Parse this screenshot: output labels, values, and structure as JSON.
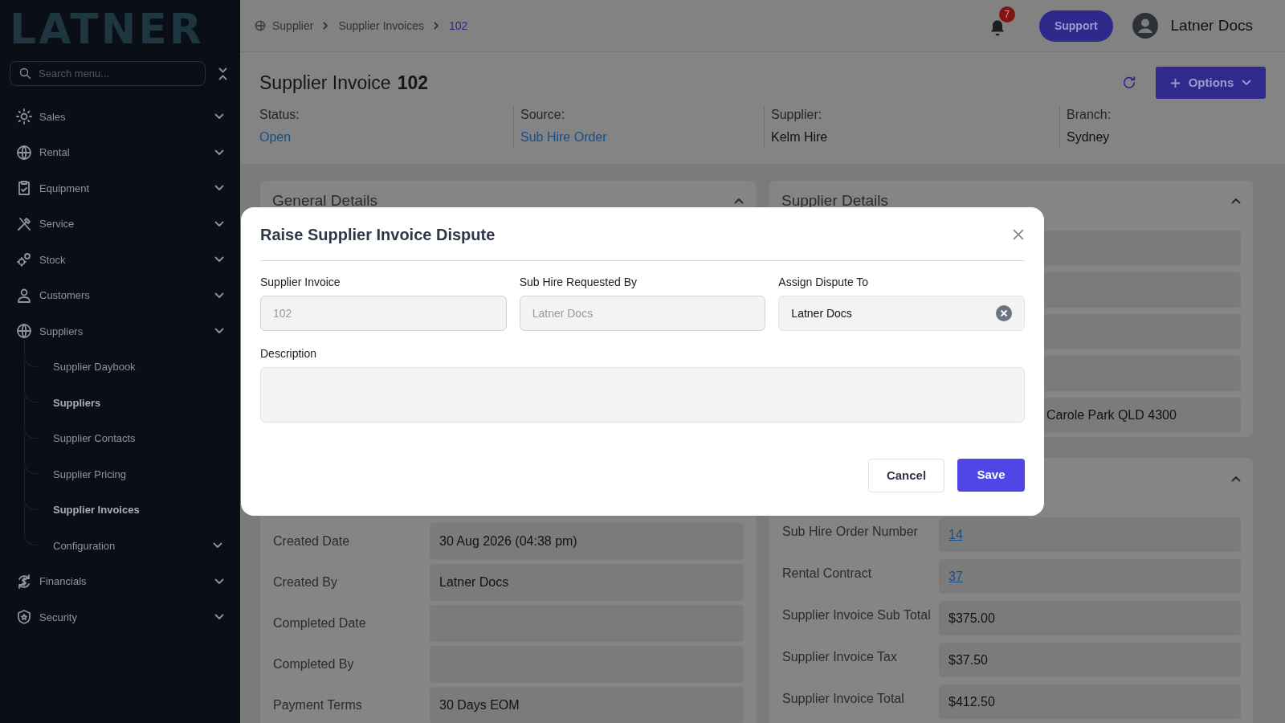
{
  "sidebar": {
    "logo": "LATNER",
    "search": {
      "placeholder": "Search menu..."
    },
    "items": [
      {
        "label": "Sales"
      },
      {
        "label": "Rental"
      },
      {
        "label": "Equipment"
      },
      {
        "label": "Service"
      },
      {
        "label": "Stock"
      },
      {
        "label": "Customers"
      },
      {
        "label": "Suppliers",
        "children": [
          {
            "label": "Supplier Daybook",
            "selected": false,
            "submenu": false
          },
          {
            "label": "Suppliers",
            "selected": true,
            "submenu": false
          },
          {
            "label": "Supplier Contacts",
            "selected": false,
            "submenu": false
          },
          {
            "label": "Supplier Pricing",
            "selected": false,
            "submenu": false
          },
          {
            "label": "Supplier Invoices",
            "selected": true,
            "submenu": false
          },
          {
            "label": "Configuration",
            "selected": false,
            "submenu": true
          }
        ]
      },
      {
        "label": "Financials"
      },
      {
        "label": "Security"
      }
    ]
  },
  "breadcrumb": [
    {
      "label": "Supplier",
      "current": false
    },
    {
      "label": "Supplier Invoices",
      "current": false
    },
    {
      "label": "102",
      "current": true
    }
  ],
  "topbar": {
    "notification_count": "7",
    "support_button": "Support",
    "user_name": "Latner Docs"
  },
  "page": {
    "title": "Supplier Invoice",
    "number": "102",
    "options_button": "Options",
    "summary": [
      {
        "label": "Status:",
        "value": "Open",
        "link": true
      },
      {
        "label": "Source:",
        "value": "Sub Hire Order",
        "link": true
      },
      {
        "label": "Supplier:",
        "value": "Kelm Hire",
        "link": false
      },
      {
        "label": "Branch:",
        "value": "Sydney",
        "link": false
      }
    ]
  },
  "general_details": {
    "title": "General Details",
    "expanded": true,
    "rows": [
      {
        "label": "Created Date",
        "value": "30 Aug 2026 (04:38 pm)"
      },
      {
        "label": "Created By",
        "value": "Latner Docs"
      },
      {
        "label": "Completed Date"
      },
      {
        "label": "Completed By"
      },
      {
        "label": "Payment Terms",
        "value": "30 Days EOM"
      }
    ]
  },
  "supplier_details": {
    "title": "Supplier Details",
    "expanded": true,
    "address_tail": "Carole Park QLD 4300"
  },
  "sub_hire_card": {
    "expanded": true,
    "rows": [
      {
        "label": "Sub Hire Order Number",
        "value": "14",
        "link": true
      },
      {
        "label": "Rental Contract",
        "value": "37",
        "link": true
      },
      {
        "label": "Supplier Invoice Sub Total",
        "value": "$375.00",
        "link": false
      },
      {
        "label": "Supplier Invoice Tax",
        "value": "$37.50",
        "link": false
      },
      {
        "label": "Supplier Invoice Total",
        "value": "$412.50",
        "link": false
      }
    ]
  },
  "modal": {
    "title": "Raise Supplier Invoice Dispute",
    "fields": [
      {
        "label": "Supplier Invoice",
        "value": "102",
        "disabled": true,
        "clearable": false
      },
      {
        "label": "Sub Hire Requested By",
        "value": "Latner Docs",
        "disabled": true,
        "clearable": false
      },
      {
        "label": "Assign Dispute To",
        "value": "Latner Docs",
        "disabled": false,
        "clearable": true
      }
    ],
    "description": {
      "label": "Description"
    },
    "buttons": [
      {
        "label": "Cancel",
        "kind": "secondary"
      },
      {
        "label": "Save",
        "kind": "primary"
      }
    ]
  }
}
